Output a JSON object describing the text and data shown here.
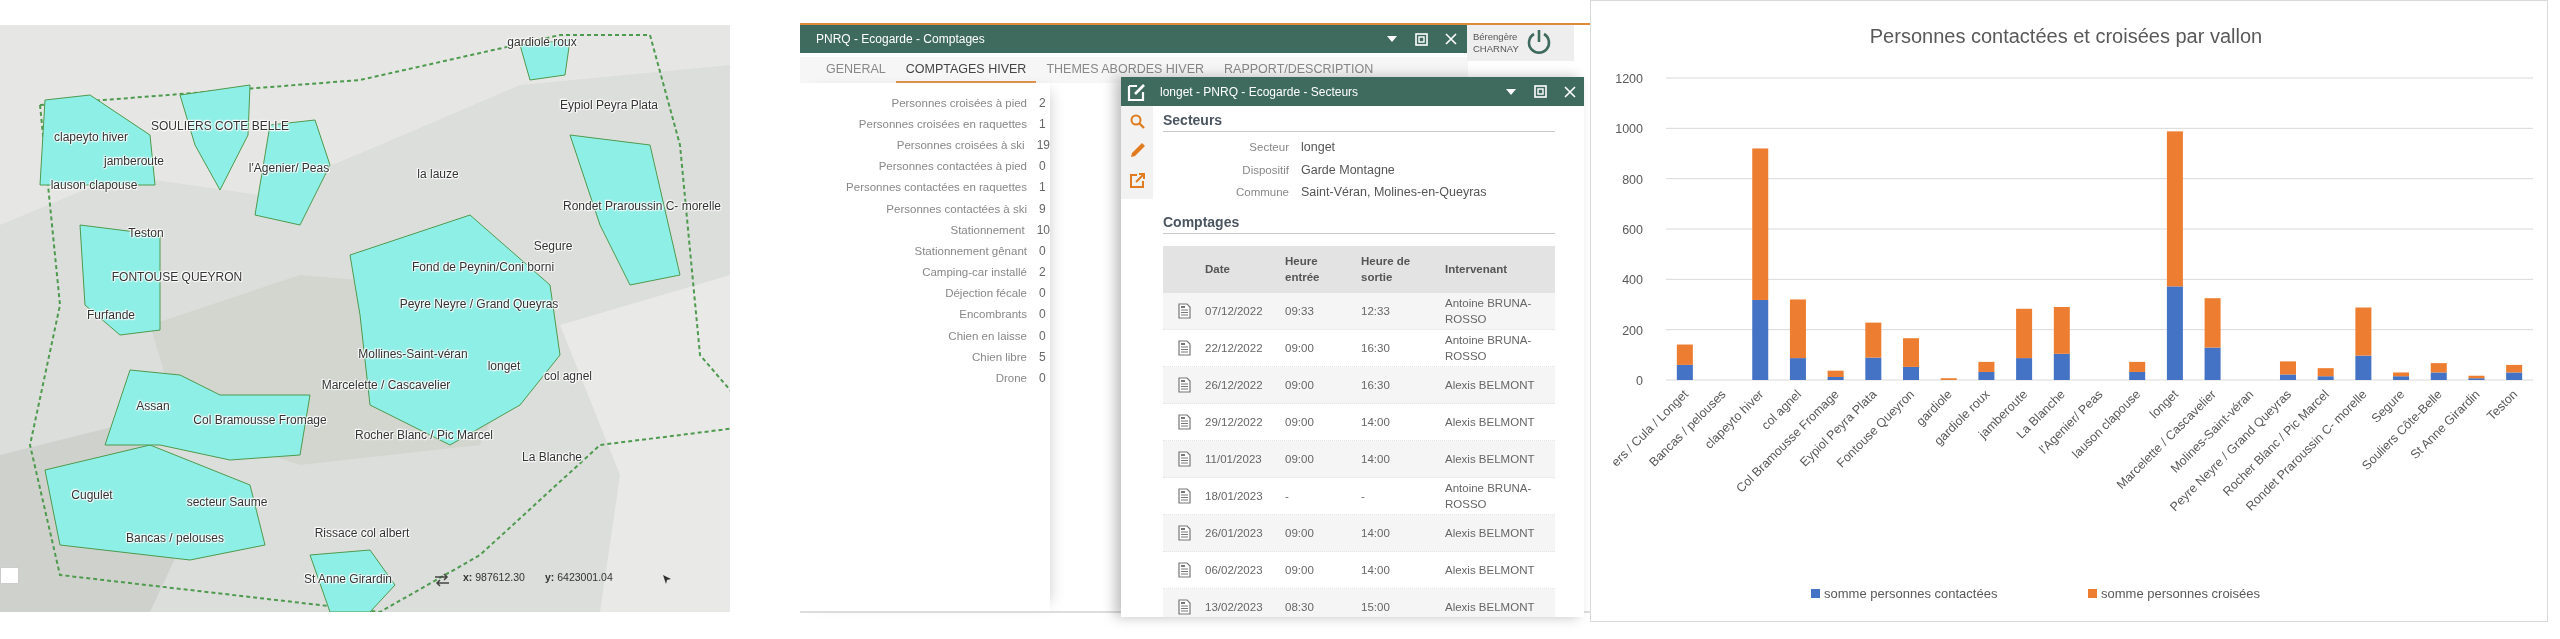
{
  "map": {
    "kind": "picture",
    "labels": [
      {
        "text": "gardiole roux"
      },
      {
        "text": "Eypiol Peyra Plata"
      },
      {
        "text": "SOULIERS COTE BELLE"
      },
      {
        "text": "clapeyto hiver"
      },
      {
        "text": "jamberoute"
      },
      {
        "text": "l'Agenier/ Peas"
      },
      {
        "text": "lauson clapouse"
      },
      {
        "text": "la lauze"
      },
      {
        "text": "Rondet Praroussin  C- morelle"
      },
      {
        "text": "Teston"
      },
      {
        "text": "Segure"
      },
      {
        "text": "Fond de Peynin/Coni borni"
      },
      {
        "text": "FONTOUSE QUEYRON"
      },
      {
        "text": "Furfande"
      },
      {
        "text": "Peyre Neyre / Grand Queyras"
      },
      {
        "text": "Mollines-Saint-véran"
      },
      {
        "text": "longet"
      },
      {
        "text": "col agnel"
      },
      {
        "text": "Marcelette / Cascavelier"
      },
      {
        "text": "Assan"
      },
      {
        "text": "Col Bramousse Fromage"
      },
      {
        "text": "Rocher Blanc / Pic Marcel"
      },
      {
        "text": "La Blanche"
      },
      {
        "text": "Cugulet"
      },
      {
        "text": "secteur Saume"
      },
      {
        "text": "Bancas  / pelouses"
      },
      {
        "text": "Rissace col albert"
      },
      {
        "text": "St Anne Girardin"
      }
    ],
    "coordinates": [
      "**x:** 987612.30",
      "**y:** 6423001.04"
    ]
  },
  "window": {
    "title": "PNRQ - Ecogarde - Comptages",
    "user": {
      "first_name": "Bérengère",
      "last_name": "CHARNAY"
    },
    "tabs": [
      {
        "label": "GENERAL",
        "selected": false
      },
      {
        "label": "COMPTAGES HIVER",
        "selected": true
      },
      {
        "label": "THEMES ABORDES HIVER",
        "selected": false
      },
      {
        "label": "RAPPORT/DESCRIPTION",
        "selected": false
      }
    ],
    "fields": [
      {
        "label": "Personnes croisées à pied",
        "value": "2"
      },
      {
        "label": "Personnes croisées en raquettes",
        "value": "1"
      },
      {
        "label": "Personnes croisées à ski",
        "value": "19"
      },
      {
        "label": "Personnes contactées à pied",
        "value": "0"
      },
      {
        "label": "Personnes contactées en raquettes",
        "value": "1"
      },
      {
        "label": "Personnes contactées à ski",
        "value": "9"
      },
      {
        "label": "Stationnement",
        "value": "10"
      },
      {
        "label": "Stationnement gênant",
        "value": "0"
      },
      {
        "label": "Camping-car installé",
        "value": "2"
      },
      {
        "label": "Déjection fécale",
        "value": "0"
      },
      {
        "label": "Encombrants",
        "value": "0"
      },
      {
        "label": "Chien en laisse",
        "value": "0"
      },
      {
        "label": "Chien libre",
        "value": "5"
      },
      {
        "label": "Drone",
        "value": "0"
      }
    ]
  },
  "dialog": {
    "title": "longet - PNRQ - Ecogarde - Secteurs",
    "section_1": "Secteurs",
    "fields": [
      {
        "label": "Secteur",
        "value": "longet"
      },
      {
        "label": "Dispositif",
        "value": "Garde Montagne"
      },
      {
        "label": "Commune",
        "value": "Saint-Véran, Molines-en-Queyras"
      }
    ],
    "section_2": "Comptages",
    "table": {
      "columns": [
        "Date",
        "Heure entrée",
        "Heure de sortie",
        "Intervenant"
      ],
      "rows": [
        [
          "07/12/2022",
          "09:33",
          "12:33",
          "Antoine BRUNA-ROSSO"
        ],
        [
          "22/12/2022",
          "09:00",
          "16:30",
          "Antoine BRUNA-ROSSO"
        ],
        [
          "26/12/2022",
          "09:00",
          "16:30",
          "Alexis BELMONT"
        ],
        [
          "29/12/2022",
          "09:00",
          "14:00",
          "Alexis BELMONT"
        ],
        [
          "11/01/2023",
          "09:00",
          "14:00",
          "Alexis BELMONT"
        ],
        [
          "18/01/2023",
          "-",
          "-",
          "Antoine BRUNA-ROSSO"
        ],
        [
          "26/01/2023",
          "09:00",
          "14:00",
          "Alexis BELMONT"
        ],
        [
          "06/02/2023",
          "09:00",
          "14:00",
          "Alexis BELMONT"
        ],
        [
          "13/02/2023",
          "08:30",
          "15:00",
          "Alexis BELMONT"
        ]
      ]
    }
  },
  "chart": {
    "chart_data": {
      "type": "bar",
      "grid": true,
      "legend": true,
      "title": "Personnes contactées et croisées par vallon",
      "stacked": true,
      "ylim": [
        0,
        1200
      ],
      "yticks": [
        0,
        200,
        400,
        600,
        800,
        1000,
        1200
      ],
      "categories": [
        "ers / Cula / Longet",
        "Bancas  / pelouses",
        "clapeyto hiver",
        "col agnel",
        "Col Bramousse Fromage",
        "Eypiol Peyra Plata",
        "Fontouse Queyron",
        "gardiole",
        "gardiole roux",
        "jamberoute",
        "La Blanche",
        "l'Agenier/ Peas",
        "lauson clapouse",
        "longet",
        "Marcelette / Cascavelier",
        "Molines-Saint-véran",
        "Peyre Neyre / Grand Queyras",
        "Rocher Blanc / Pic Marcel",
        "Rondet Praroussin  C- morelle",
        "Segure",
        "Souliers Côte-Belle",
        "St Anne Girardin",
        "Teston"
      ],
      "series": [
        {
          "name": "somme personnes contactées",
          "color": "#4472c4",
          "values": [
            60,
            0,
            318,
            87,
            12,
            89,
            52,
            0,
            32,
            87,
            104,
            0,
            32,
            372,
            129,
            0,
            22,
            15,
            97,
            15,
            30,
            7,
            30
          ]
        },
        {
          "name": "somme personnes croisées",
          "color": "#ed7d31",
          "values": [
            81,
            0,
            602,
            233,
            25,
            139,
            114,
            7,
            40,
            196,
            186,
            0,
            40,
            616,
            196,
            0,
            52,
            32,
            191,
            15,
            37,
            10,
            30
          ]
        }
      ]
    }
  }
}
